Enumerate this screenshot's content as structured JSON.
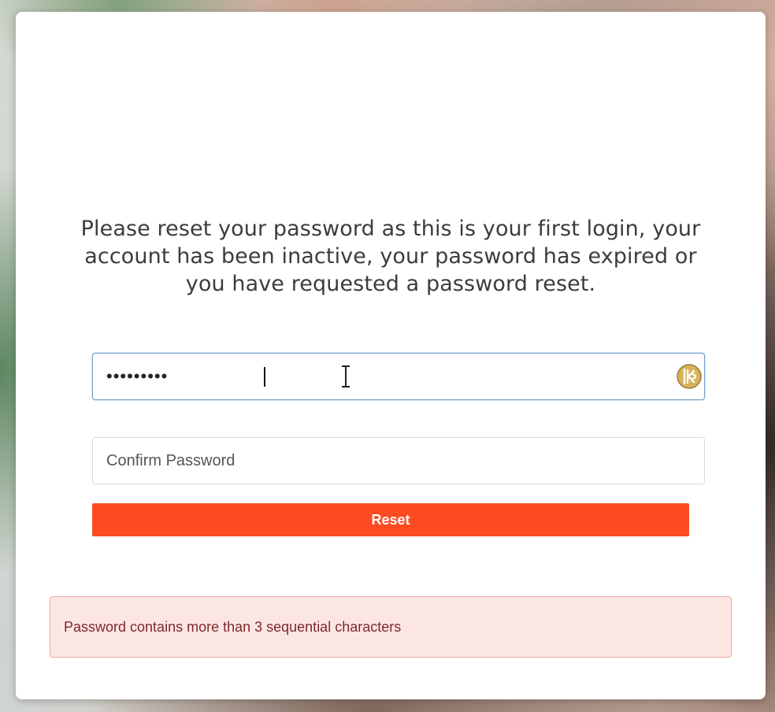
{
  "message": "Please reset your password as this is your first login, your account has been inactive, your password has expired or you have requested a password reset.",
  "password_field": {
    "value": "•••••••••",
    "manager_icon": "keeper-icon"
  },
  "confirm_field": {
    "placeholder": "Confirm Password"
  },
  "reset_button": {
    "label": "Reset",
    "color": "#fc4b20"
  },
  "error": {
    "text": "Password contains more than 3 sequential characters",
    "background": "#fce6e4"
  }
}
